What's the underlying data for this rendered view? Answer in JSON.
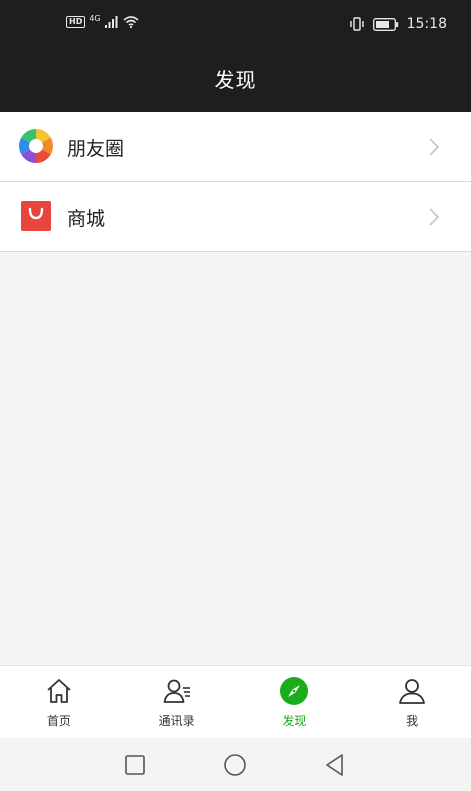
{
  "status_bar": {
    "left_badge": "HD",
    "network": "4G",
    "time": "15:18"
  },
  "header": {
    "title": "发现"
  },
  "list_items": [
    {
      "label": "朋友圈",
      "icon": "moments-aperture-icon"
    },
    {
      "label": "商城",
      "icon": "shopping-bag-icon"
    }
  ],
  "bottom_nav": [
    {
      "label": "首页",
      "icon": "home-icon",
      "active": false
    },
    {
      "label": "通讯录",
      "icon": "contacts-icon",
      "active": false
    },
    {
      "label": "发现",
      "icon": "compass-icon",
      "active": true
    },
    {
      "label": "我",
      "icon": "person-icon",
      "active": false
    }
  ],
  "colors": {
    "header_bg": "#1e1e21",
    "accent_green": "#1aad19",
    "shop_red": "#e8453c"
  },
  "system_nav": [
    "square-recent-icon",
    "circle-home-icon",
    "triangle-back-icon"
  ]
}
